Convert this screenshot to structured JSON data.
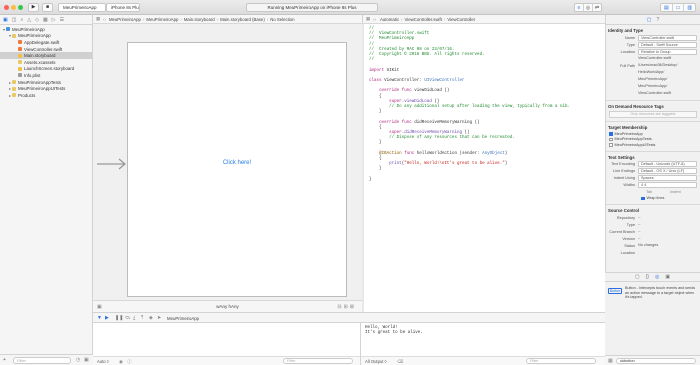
{
  "toolbar": {
    "scheme": "MeuPrimeiroApp",
    "device": "iPhone 8s Plus",
    "status": "Running MeuPrimeiroApp on iPhone 8s Plus"
  },
  "navigator": {
    "items": [
      {
        "label": "MeuPrimeiroApp",
        "depth": 0,
        "icon": "xcodeproj",
        "disclosure": "▾"
      },
      {
        "label": "MeuPrimeiroApp",
        "depth": 1,
        "icon": "folder",
        "disclosure": "▾"
      },
      {
        "label": "AppDelegate.swift",
        "depth": 2,
        "icon": "swift",
        "disclosure": ""
      },
      {
        "label": "ViewController.swift",
        "depth": 2,
        "icon": "swift",
        "disclosure": ""
      },
      {
        "label": "Main.storyboard",
        "depth": 2,
        "icon": "storyboard",
        "disclosure": "",
        "selected": true
      },
      {
        "label": "Assets.xcassets",
        "depth": 2,
        "icon": "folder",
        "disclosure": ""
      },
      {
        "label": "LaunchScreen.storyboard",
        "depth": 2,
        "icon": "storyboard",
        "disclosure": ""
      },
      {
        "label": "Info.plist",
        "depth": 2,
        "icon": "plist",
        "disclosure": ""
      },
      {
        "label": "MeuPrimeiroAppTests",
        "depth": 1,
        "icon": "folder",
        "disclosure": "▸"
      },
      {
        "label": "MeuPrimeiroAppUITests",
        "depth": 1,
        "icon": "folder",
        "disclosure": "▸"
      },
      {
        "label": "Products",
        "depth": 1,
        "icon": "folder",
        "disclosure": "▸"
      }
    ]
  },
  "storyboard": {
    "jumpbar": [
      "MeuPrimeiroApp",
      "MeuPrimeiroApp",
      "Main.storyboard",
      "Main.storyboard (Base)",
      "No Selection"
    ],
    "button_label": "Click here!",
    "size_class": "wAny hAny"
  },
  "editor": {
    "jumpbar": [
      "Automatic",
      "ViewController.swift",
      "ViewController"
    ],
    "lines": [
      [
        [
          "//",
          "cm"
        ]
      ],
      [
        [
          "//  ViewController.swift",
          "cm"
        ]
      ],
      [
        [
          "//  MeuPrimeiroApp",
          "cm"
        ]
      ],
      [
        [
          "//",
          "cm"
        ]
      ],
      [
        [
          "//  Created by MAC 08 on 23/07/16.",
          "cm"
        ]
      ],
      [
        [
          "//  Copyright © 2016 BNG. All rights reserved.",
          "cm"
        ]
      ],
      [
        [
          "//",
          "cm"
        ]
      ],
      [
        [
          "",
          ""
        ]
      ],
      [
        [
          "import",
          "kw"
        ],
        [
          " UIKit",
          ""
        ]
      ],
      [
        [
          "",
          ""
        ]
      ],
      [
        [
          "class",
          "kw"
        ],
        [
          " ViewController: ",
          ""
        ],
        [
          "UIViewController",
          "ty"
        ]
      ],
      [
        [
          "",
          ""
        ]
      ],
      [
        [
          "    ",
          ""
        ],
        [
          "override",
          "kw"
        ],
        [
          " ",
          ""
        ],
        [
          "func",
          "kw"
        ],
        [
          " viewDidLoad ()",
          ""
        ]
      ],
      [
        [
          "    {",
          ""
        ]
      ],
      [
        [
          "        ",
          ""
        ],
        [
          "super",
          "kw"
        ],
        [
          ".",
          ""
        ],
        [
          "viewDidLoad",
          "fn"
        ],
        [
          " ()",
          ""
        ]
      ],
      [
        [
          "        // Do any additional setup after loading the view, typically from a nib.",
          "cm"
        ]
      ],
      [
        [
          "    }",
          ""
        ]
      ],
      [
        [
          "",
          ""
        ]
      ],
      [
        [
          "    ",
          ""
        ],
        [
          "override",
          "kw"
        ],
        [
          " ",
          ""
        ],
        [
          "func",
          "kw"
        ],
        [
          " didReceiveMemoryWarning ()",
          ""
        ]
      ],
      [
        [
          "    {",
          ""
        ]
      ],
      [
        [
          "        ",
          ""
        ],
        [
          "super",
          "kw"
        ],
        [
          ".",
          ""
        ],
        [
          "didReceiveMemoryWarning",
          "fn"
        ],
        [
          " ()",
          ""
        ]
      ],
      [
        [
          "        // Dispose of any resources that can be recreated.",
          "cm"
        ]
      ],
      [
        [
          "    }",
          ""
        ]
      ],
      [
        [
          "",
          ""
        ]
      ],
      [
        [
          "    ",
          ""
        ],
        [
          "@IBAction",
          "at"
        ],
        [
          " ",
          ""
        ],
        [
          "func",
          "kw"
        ],
        [
          " helloWorldAction (sender: ",
          ""
        ],
        [
          "AnyObject",
          "ty"
        ],
        [
          ")",
          ""
        ]
      ],
      [
        [
          "    {",
          ""
        ]
      ],
      [
        [
          "        ",
          ""
        ],
        [
          "print",
          "fn"
        ],
        [
          "(",
          ""
        ],
        [
          "\"Hello, World!\\nIt's great to be alive.\"",
          "st"
        ],
        [
          ")",
          ""
        ]
      ],
      [
        [
          "    }",
          ""
        ]
      ],
      [
        [
          "",
          ""
        ]
      ],
      [
        [
          "}",
          ""
        ]
      ]
    ]
  },
  "debug": {
    "target": "MeuPrimeiroApp",
    "auto_label": "Auto ◊",
    "output_label": "All Output ◊",
    "filter_placeholder": "Filter",
    "console_text": "Hello, World!\nIt's great to be alive."
  },
  "inspector": {
    "identity_title": "Identity and Type",
    "identity": [
      {
        "label": "Name",
        "value": "ViewController.swift",
        "field": true
      },
      {
        "label": "Type",
        "value": "Default - Swift Source",
        "field": true
      },
      {
        "label": "Location",
        "value": "Relative to Group",
        "field": true
      },
      {
        "label": "",
        "value": "ViewController.swift",
        "field": false
      },
      {
        "label": "Full Path",
        "value": "/Users/mac08/Desktop/",
        "field": false
      },
      {
        "label": "",
        "value": "HelloWorldApp/",
        "field": false
      },
      {
        "label": "",
        "value": "MeuPrimeiroApp/",
        "field": false
      },
      {
        "label": "",
        "value": "MeuPrimeiroApp/",
        "field": false
      },
      {
        "label": "",
        "value": "ViewController.swift",
        "field": false
      }
    ],
    "odr_title": "On Demand Resource Tags",
    "odr_placeholder": "Only resources are taggable",
    "target_title": "Target Membership",
    "targets": [
      {
        "label": "MeuPrimeiroApp",
        "checked": true
      },
      {
        "label": "MeuPrimeiroAppTests",
        "checked": false
      },
      {
        "label": "MeuPrimeiroAppUITests",
        "checked": false
      }
    ],
    "text_title": "Text Settings",
    "text": [
      {
        "label": "Text Encoding",
        "value": "Default - Unicode (UTF-8)"
      },
      {
        "label": "Line Endings",
        "value": "Default - OS X / Unix (LF)"
      },
      {
        "label": "Indent Using",
        "value": "Spaces"
      },
      {
        "label": "Widths",
        "value": "4      4"
      }
    ],
    "widths_sub": [
      "Tab",
      "Indent"
    ],
    "wrap_lines": "Wrap lines",
    "source_title": "Source Control",
    "source": [
      {
        "label": "Repository",
        "value": "--"
      },
      {
        "label": "Type",
        "value": "--"
      },
      {
        "label": "Current Branch",
        "value": "--"
      },
      {
        "label": "Version",
        "value": "--"
      },
      {
        "label": "Status",
        "value": "No changes"
      },
      {
        "label": "Location",
        "value": ""
      }
    ],
    "library_name": "Button",
    "library_desc": "Button - Intercepts touch events and sends an action message to a target object when it's tapped.",
    "library_search": "ukbutton"
  },
  "colors": {
    "accent": "#2a6fe0",
    "code_comment": "#1d8a2b",
    "code_keyword": "#b0277d"
  }
}
